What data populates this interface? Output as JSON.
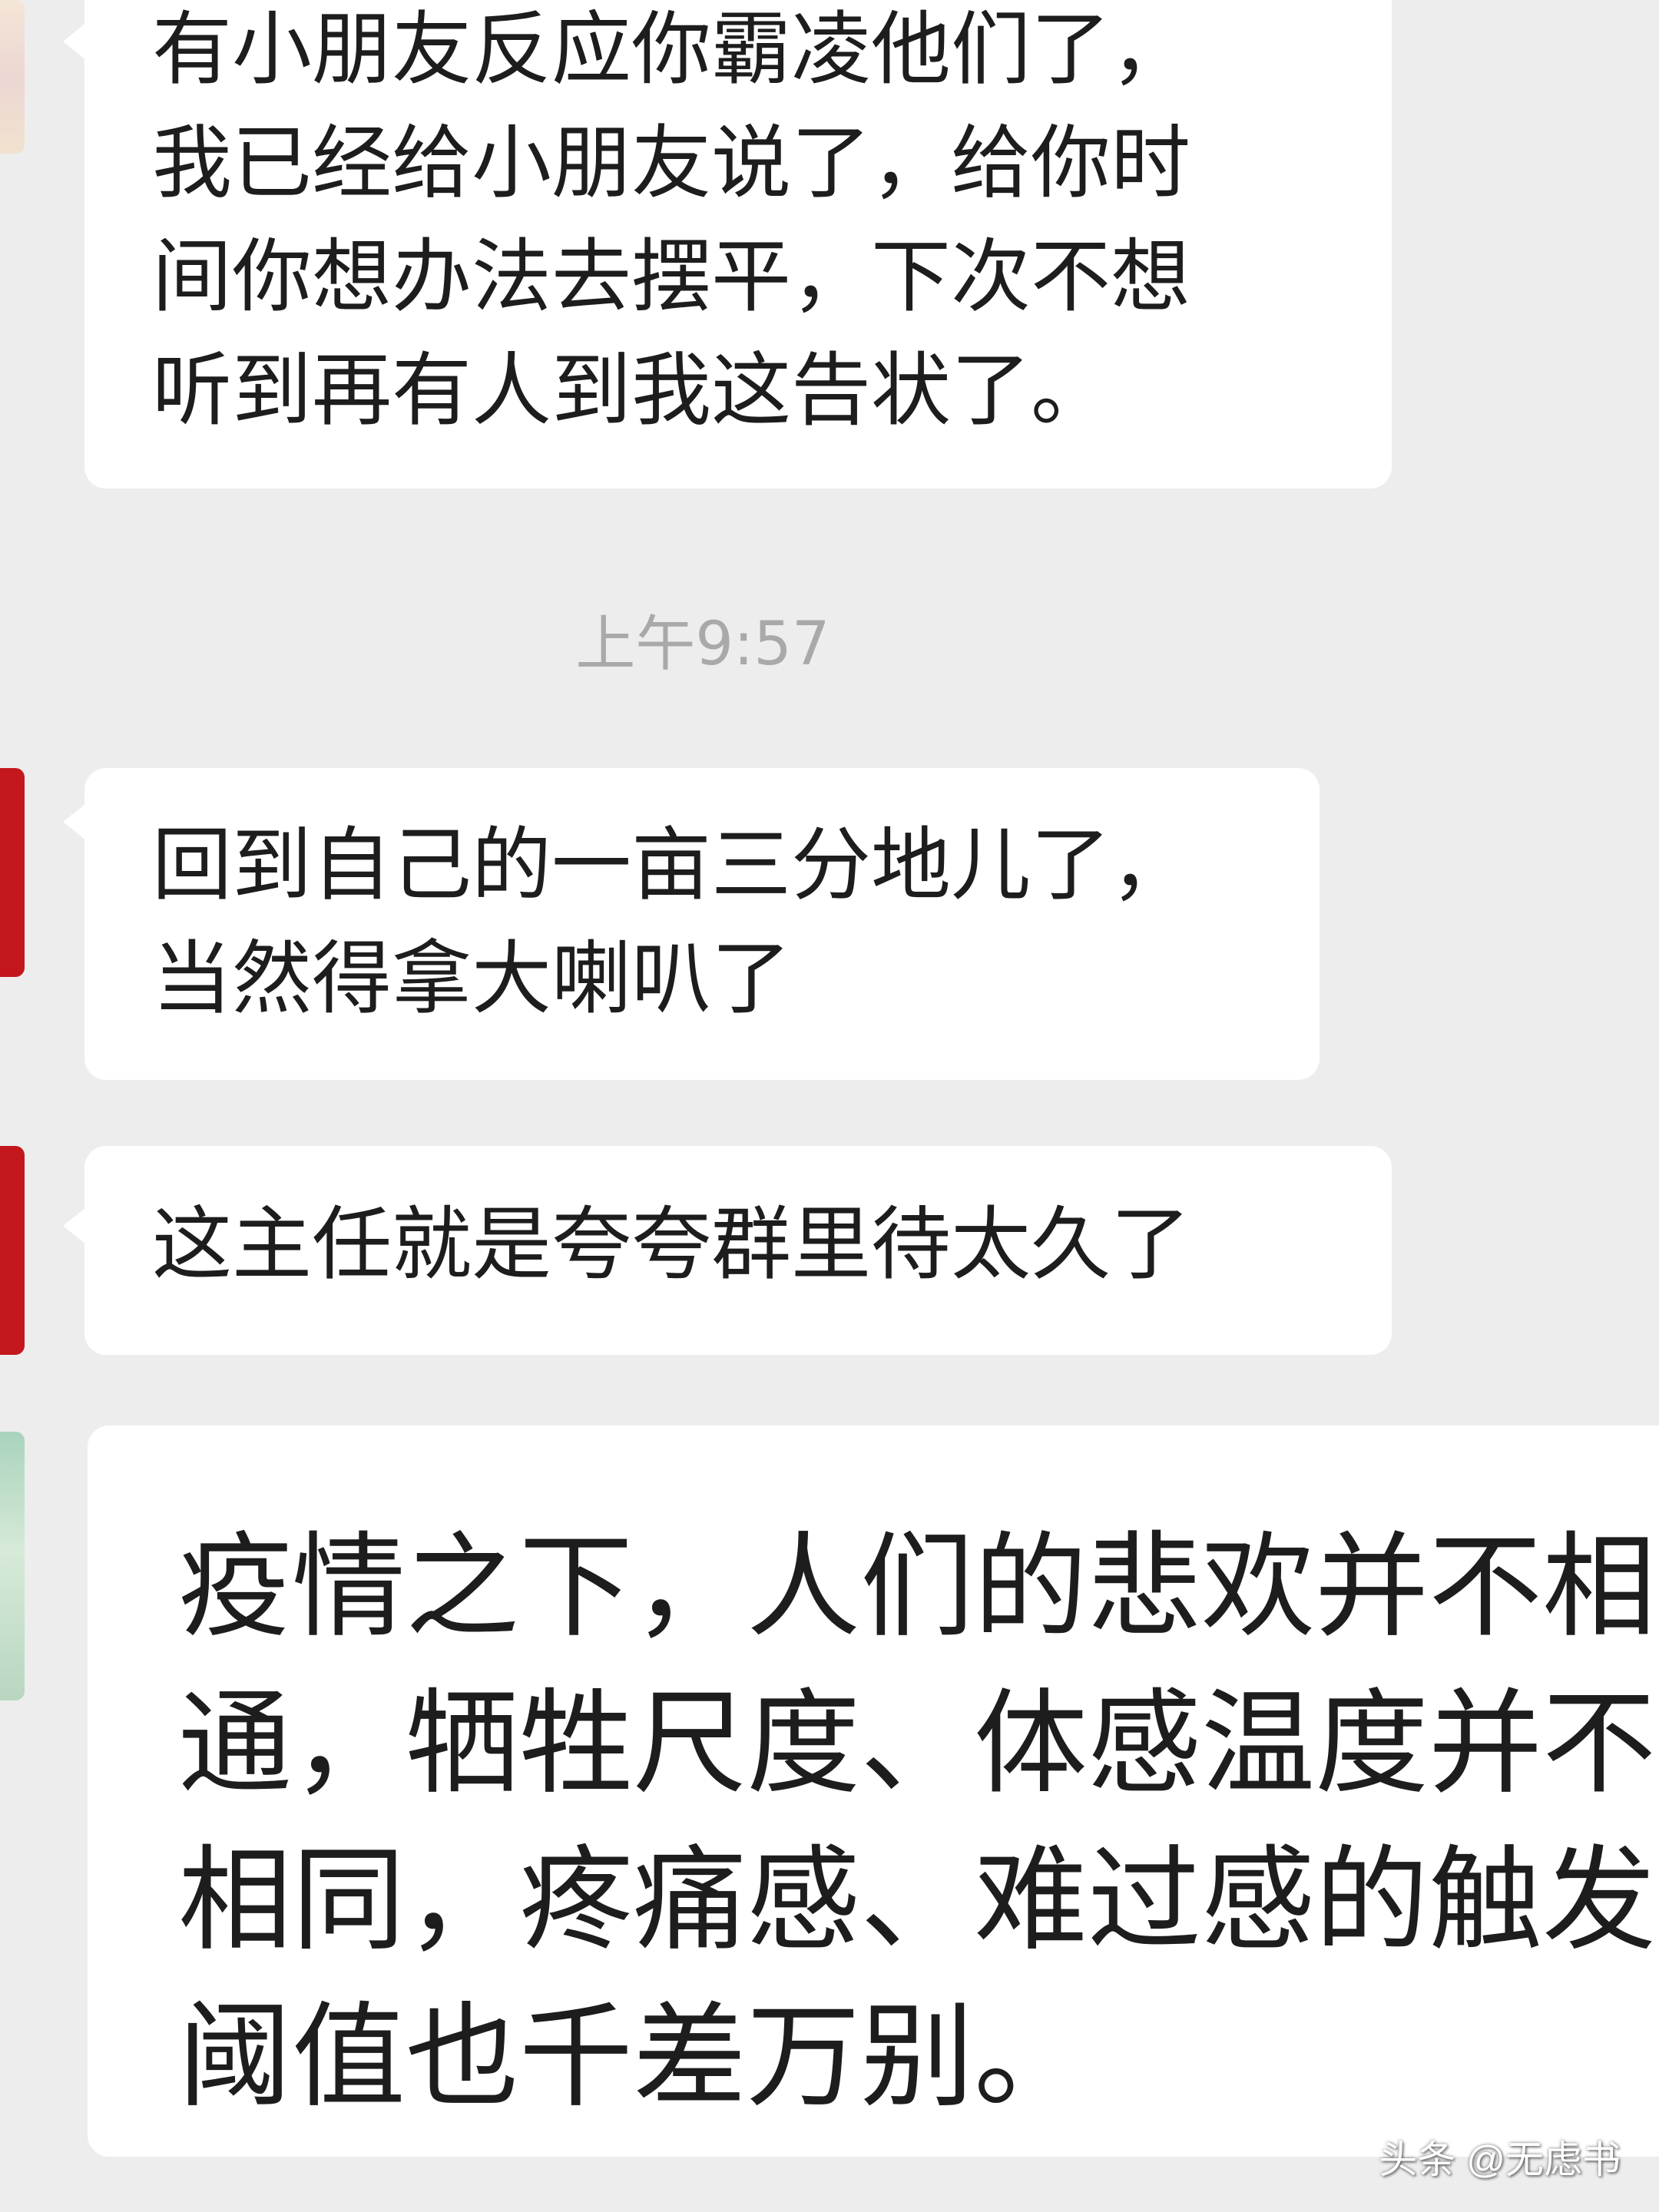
{
  "timestamp": "上午9:57",
  "messages": [
    {
      "avatar_style": "pastel",
      "text": "有小朋友反应你霸凌他们了，\n我已经给小朋友说了，给你时\n间你想办法去摆平，下次不想\n听到再有人到我这告状了。"
    },
    {
      "avatar_style": "red",
      "text": "回到自己的一亩三分地儿了，\n当然得拿大喇叭了"
    },
    {
      "avatar_style": "red",
      "text": "这主任就是夸夸群里待太久了"
    },
    {
      "avatar_style": "green",
      "text": "疫情之下，人们的悲欢并不相\n通，牺牲尺度、体感温度并不\n相同，疼痛感、难过感的触发\n阈值也千差万别。"
    }
  ],
  "watermark": "头条 @无虑书",
  "colors": {
    "background": "#ededed",
    "bubble": "#ffffff",
    "text": "#1d1d1d",
    "timestamp": "#a9a9a9"
  }
}
